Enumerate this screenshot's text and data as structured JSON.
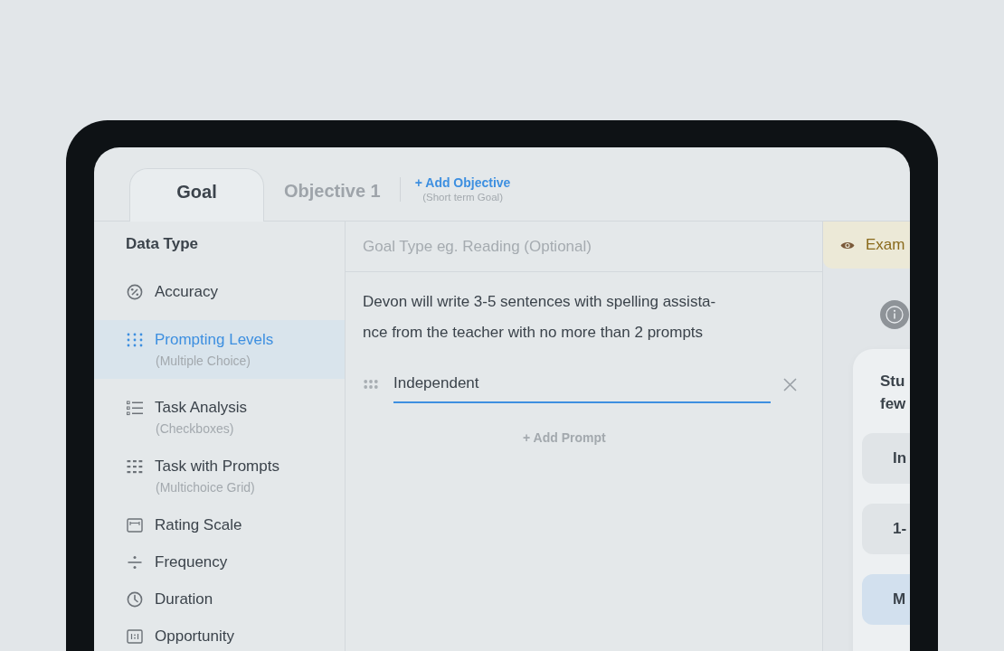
{
  "tabs": [
    {
      "label": "Goal",
      "selected": true
    },
    {
      "label": "Objective 1",
      "selected": false
    }
  ],
  "add_objective": {
    "label": "+ Add Objective",
    "note": "(Short term Goal)"
  },
  "sidebar": {
    "title": "Data Type",
    "items": [
      {
        "label": "Accuracy",
        "selected": false
      },
      {
        "label": "Prompting Levels",
        "sublabel": "(Multiple Choice)",
        "selected": true
      },
      {
        "label": "Task Analysis",
        "sublabel": "(Checkboxes)",
        "selected": false
      },
      {
        "label": "Task with Prompts",
        "sublabel": "(Multichoice Grid)",
        "selected": false
      },
      {
        "label": "Rating Scale",
        "selected": false
      },
      {
        "label": "Frequency",
        "selected": false
      },
      {
        "label": "Duration",
        "selected": false
      },
      {
        "label": "Opportunity",
        "selected": false
      }
    ]
  },
  "editor": {
    "goal_type": {
      "placeholder": "Goal Type eg. Reading (Optional)"
    },
    "description": "Devon will write 3-5 sentences with spelling assista-\nnce from the teacher with no more than 2 prompts",
    "prompts": [
      {
        "value": "Independent",
        "focused": true
      }
    ],
    "add_prompt": "+ Add Prompt"
  },
  "example": {
    "banner": "Exam",
    "question": "Stu\nfew",
    "options": [
      {
        "label": "In",
        "selected": false
      },
      {
        "label": "1-",
        "selected": false
      },
      {
        "label": "M",
        "selected": true
      }
    ]
  }
}
